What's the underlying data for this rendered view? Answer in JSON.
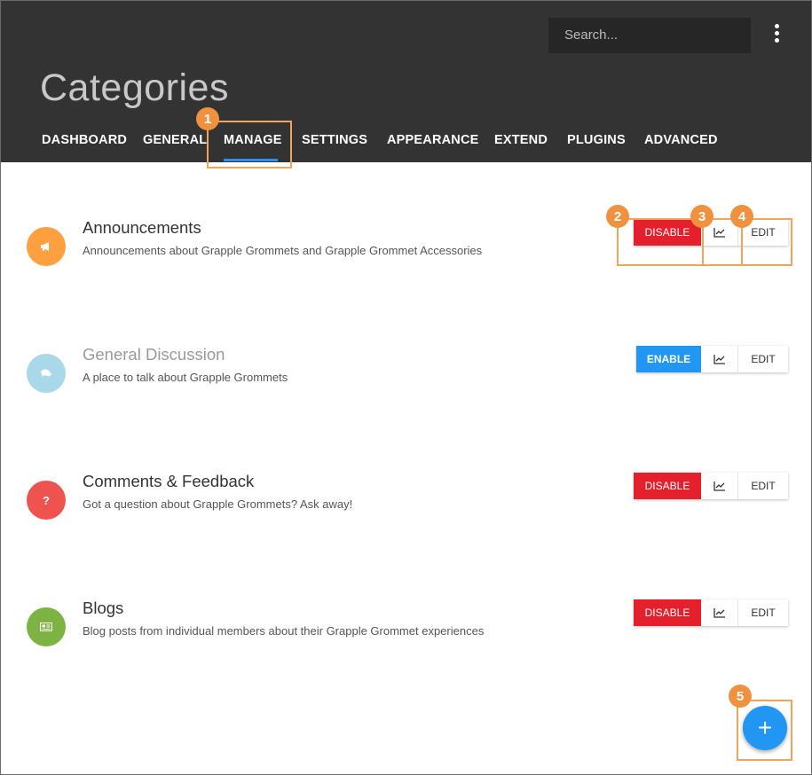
{
  "header": {
    "search_placeholder": "Search...",
    "title": "Categories",
    "tabs": [
      {
        "label": "DASHBOARD"
      },
      {
        "label": "GENERAL"
      },
      {
        "label": "MANAGE"
      },
      {
        "label": "SETTINGS"
      },
      {
        "label": "APPEARANCE"
      },
      {
        "label": "EXTEND"
      },
      {
        "label": "PLUGINS"
      },
      {
        "label": "ADVANCED"
      }
    ],
    "active_tab": "MANAGE"
  },
  "categories": [
    {
      "title": "Announcements",
      "description": "Announcements about Grapple Grommets and Grapple Grommet Accessories",
      "icon": "megaphone-icon",
      "icon_glyph": "📢",
      "color": "#ffa040",
      "enabled": true,
      "toggle_label": "DISABLE",
      "edit_label": "EDIT"
    },
    {
      "title": "General Discussion",
      "description": "A place to talk about Grapple Grommets",
      "icon": "chat-bubbles-icon",
      "icon_glyph": "💬",
      "color": "#a8d8ea",
      "enabled": false,
      "toggle_label": "ENABLE",
      "edit_label": "EDIT"
    },
    {
      "title": "Comments & Feedback",
      "description": "Got a question about Grapple Grommets? Ask away!",
      "icon": "question-mark-icon",
      "icon_glyph": "?",
      "color": "#ef5350",
      "enabled": true,
      "toggle_label": "DISABLE",
      "edit_label": "EDIT"
    },
    {
      "title": "Blogs",
      "description": "Blog posts from individual members about their Grapple Grommet experiences",
      "icon": "newspaper-icon",
      "icon_glyph": "▤",
      "color": "#7cb342",
      "enabled": true,
      "toggle_label": "DISABLE",
      "edit_label": "EDIT"
    }
  ],
  "fab": {
    "label": "+",
    "icon": "plus-icon"
  },
  "callouts": [
    "1",
    "2",
    "3",
    "4",
    "5"
  ],
  "colors": {
    "header_bg": "#333333",
    "accent": "#2196f3",
    "disable": "#e3202c",
    "callout": "#f0913f"
  }
}
